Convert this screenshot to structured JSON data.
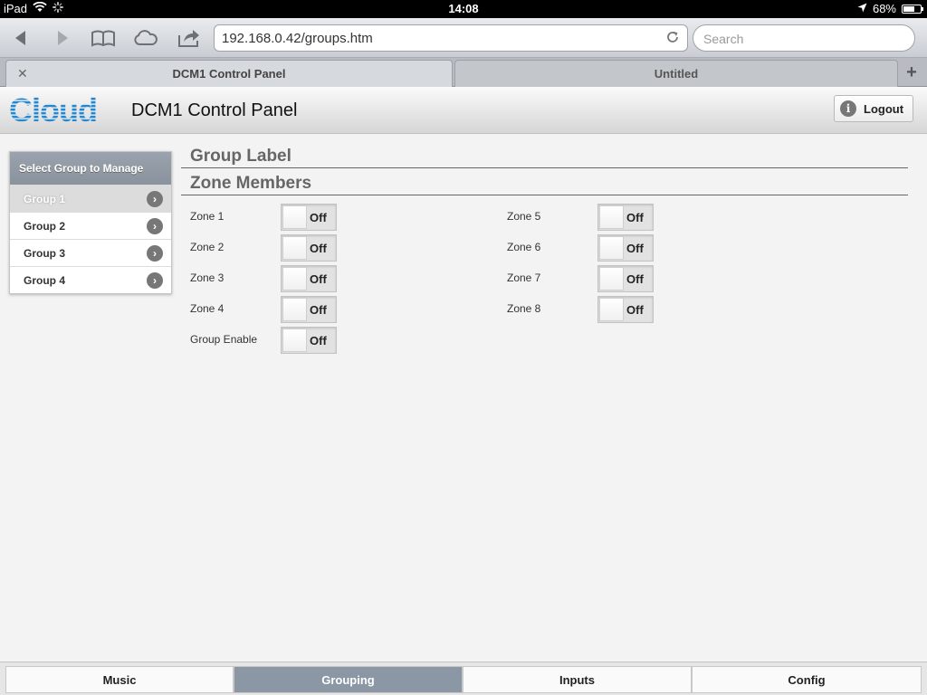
{
  "status_bar": {
    "device": "iPad",
    "time": "14:08",
    "battery": "68%",
    "battery_level": 0.68
  },
  "browser": {
    "url": "192.168.0.42/groups.htm",
    "search_placeholder": "Search",
    "tabs": [
      {
        "label": "DCM1 Control Panel",
        "active": true
      },
      {
        "label": "Untitled",
        "active": false
      }
    ]
  },
  "header": {
    "logo_text": "Cloud",
    "title": "DCM1 Control Panel",
    "logout_label": "Logout"
  },
  "sidebar": {
    "heading": "Select Group to Manage",
    "items": [
      {
        "label": "Group 1",
        "active": true
      },
      {
        "label": "Group 2",
        "active": false
      },
      {
        "label": "Group 3",
        "active": false
      },
      {
        "label": "Group 4",
        "active": false
      }
    ]
  },
  "main": {
    "group_label_heading": "Group Label",
    "zone_members_heading": "Zone Members",
    "zones": [
      {
        "label": "Zone 1",
        "state": "Off"
      },
      {
        "label": "Zone 2",
        "state": "Off"
      },
      {
        "label": "Zone 3",
        "state": "Off"
      },
      {
        "label": "Zone 4",
        "state": "Off"
      },
      {
        "label": "Zone 5",
        "state": "Off"
      },
      {
        "label": "Zone 6",
        "state": "Off"
      },
      {
        "label": "Zone 7",
        "state": "Off"
      },
      {
        "label": "Zone 8",
        "state": "Off"
      }
    ],
    "group_enable": {
      "label": "Group Enable",
      "state": "Off"
    }
  },
  "bottom_nav": {
    "items": [
      {
        "label": "Music",
        "active": false
      },
      {
        "label": "Grouping",
        "active": true
      },
      {
        "label": "Inputs",
        "active": false
      },
      {
        "label": "Config",
        "active": false
      }
    ]
  },
  "colors": {
    "accent": "#8b97a4",
    "logo_blue": "#2a86c8"
  }
}
